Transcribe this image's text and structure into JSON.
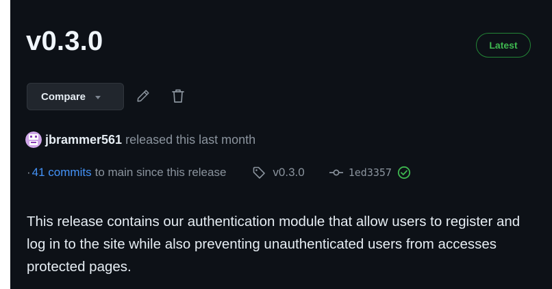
{
  "release": {
    "title": "v0.3.0",
    "badge": "Latest",
    "compare_label": "Compare",
    "author": "jbrammer561",
    "released_text": "released this last month",
    "commits_prefix": "·",
    "commits_link": "41 commits",
    "commits_suffix": "to main since this release",
    "tag": "v0.3.0",
    "commit_sha": "1ed3357",
    "description": "This release contains our authentication module that allow users to register and log in to the site while also preventing unauthenticated users from accesses protected pages."
  },
  "icons": {
    "edit": "pencil-icon",
    "delete": "trash-icon",
    "tag": "tag-icon",
    "commit": "git-commit-icon",
    "verified": "check-circle-icon"
  },
  "colors": {
    "background": "#0d1117",
    "text": "#e6edf3",
    "muted": "#8b949e",
    "link": "#4493f8",
    "success": "#3fb950",
    "badge_border": "#238636",
    "button_bg": "#21262d"
  }
}
